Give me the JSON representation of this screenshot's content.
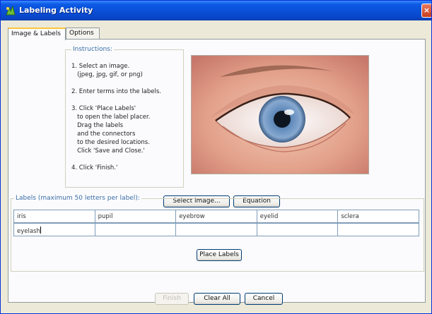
{
  "window": {
    "title": "Labeling Activity",
    "close_label": "×"
  },
  "tabs": [
    {
      "label": "Image & Labels",
      "active": true
    },
    {
      "label": "Options",
      "active": false
    }
  ],
  "instructions": {
    "legend": "Instructions:",
    "lines": [
      "1. Select an image.",
      "   (jpeg, jpg, gif, or png)",
      "",
      "2. Enter terms into the labels.",
      "",
      "3. Click 'Place Labels'",
      "   to open the label placer.",
      "   Drag the labels",
      "   and the connectors",
      "   to the desired locations.",
      "   Click 'Save and Close.'",
      "",
      "4. Click 'Finish.'"
    ]
  },
  "image_buttons": {
    "select_image": "Select image...",
    "equation": "Equation"
  },
  "labels_section": {
    "legend": "Labels (maximum 50 letters per label):",
    "rows": [
      [
        "iris",
        "pupil",
        "eyebrow",
        "eyelid",
        "sclera"
      ],
      [
        "eyelash",
        "",
        "",
        "",
        ""
      ]
    ],
    "place_labels": "Place Labels"
  },
  "footer": {
    "finish": "Finish",
    "clear_all": "Clear All",
    "cancel": "Cancel"
  },
  "colors": {
    "titlebar": "#0a4fd6",
    "legend_text": "#3a6ea5",
    "iris": "#5a86b8"
  }
}
